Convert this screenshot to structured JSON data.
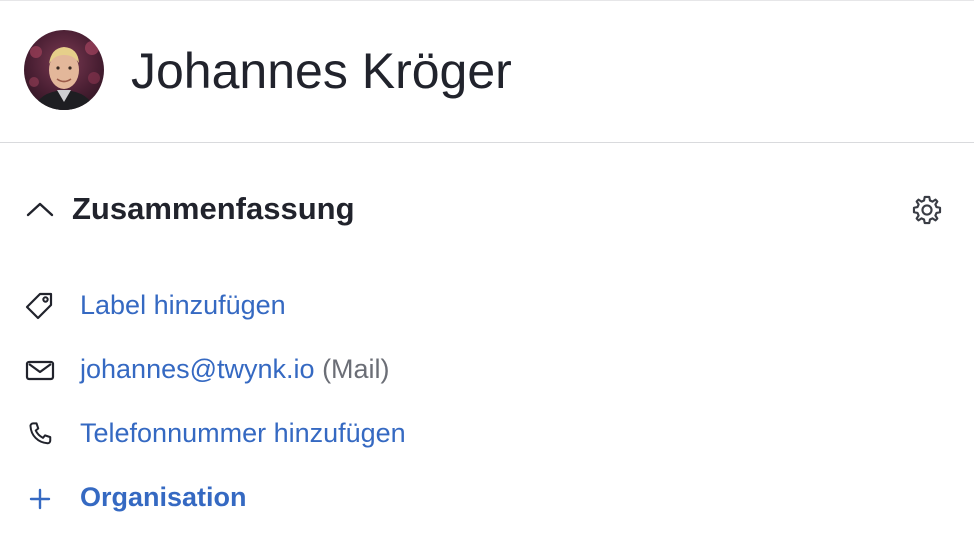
{
  "person": {
    "name": "Johannes Kröger"
  },
  "summary": {
    "title": "Zusammenfassung"
  },
  "fields": {
    "label_action": "Label hinzufügen",
    "email": "johannes@twynk.io",
    "email_type": "(Mail)",
    "phone_action": "Telefonnummer hinzufügen",
    "organisation_action": "Organisation"
  },
  "colors": {
    "link": "#3569c2",
    "text": "#21232c",
    "muted": "#6b6e76",
    "divider": "#d9dadd"
  },
  "icons": {
    "collapse": "chevron-up-icon",
    "settings": "gear-icon",
    "label": "tag-icon",
    "email": "envelope-icon",
    "phone": "phone-icon",
    "organisation": "plus-icon"
  }
}
